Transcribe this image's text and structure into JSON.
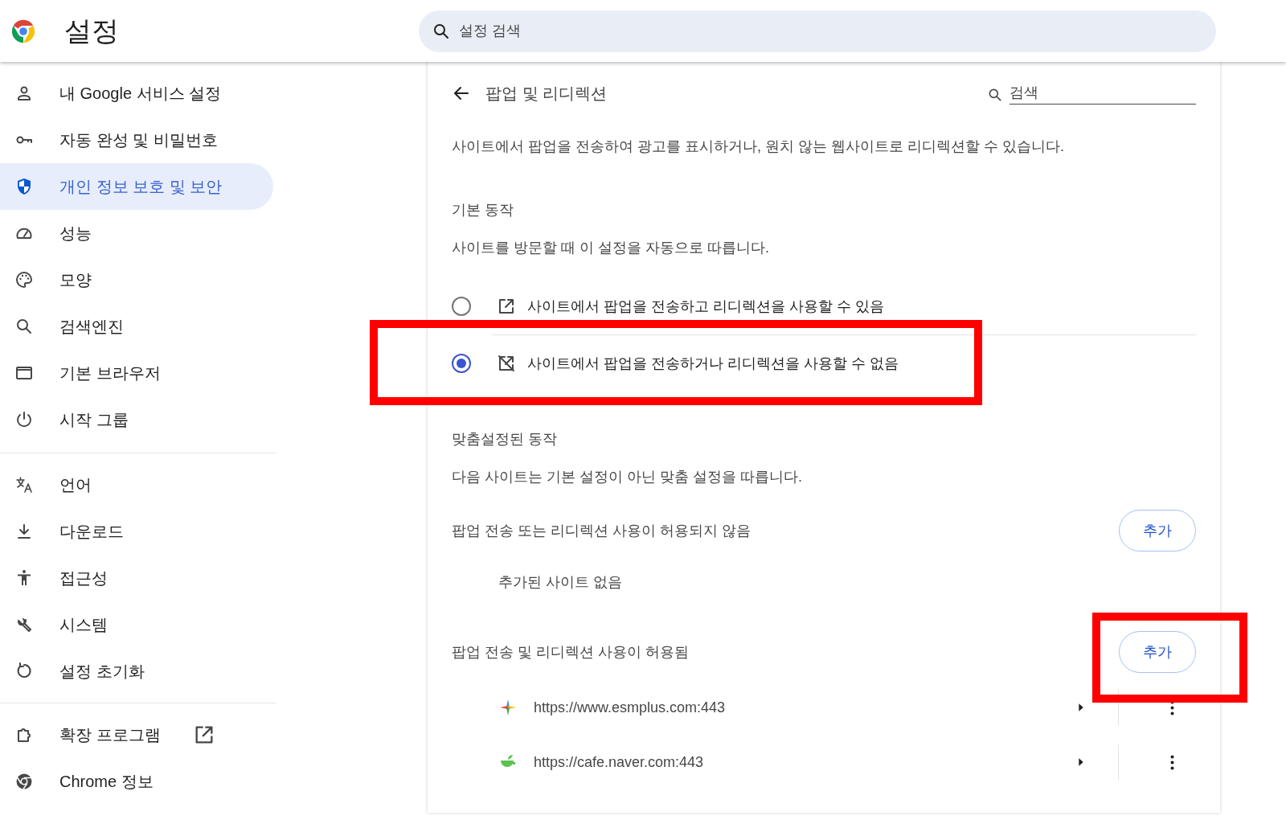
{
  "header": {
    "title": "설정",
    "search": {
      "placeholder": "설정 검색"
    }
  },
  "sidebar": {
    "groups": [
      {
        "items": [
          {
            "label": "내 Google 서비스 설정",
            "selected": false,
            "external": false
          },
          {
            "label": "자동 완성 및 비밀번호",
            "selected": false,
            "external": false
          },
          {
            "label": "개인 정보 보호 및 보안",
            "selected": true,
            "external": false
          },
          {
            "label": "성능",
            "selected": false,
            "external": false
          },
          {
            "label": "모양",
            "selected": false,
            "external": false
          },
          {
            "label": "검색엔진",
            "selected": false,
            "external": false
          },
          {
            "label": "기본 브라우저",
            "selected": false,
            "external": false
          },
          {
            "label": "시작 그룹",
            "selected": false,
            "external": false
          }
        ]
      },
      {
        "items": [
          {
            "label": "언어",
            "selected": false,
            "external": false
          },
          {
            "label": "다운로드",
            "selected": false,
            "external": false
          },
          {
            "label": "접근성",
            "selected": false,
            "external": false
          },
          {
            "label": "시스템",
            "selected": false,
            "external": false
          },
          {
            "label": "설정 초기화",
            "selected": false,
            "external": false
          }
        ]
      },
      {
        "items": [
          {
            "label": "확장 프로그램",
            "selected": false,
            "external": true
          },
          {
            "label": "Chrome 정보",
            "selected": false,
            "external": false
          }
        ]
      }
    ]
  },
  "page": {
    "title": "팝업 및 리디렉션",
    "search": {
      "placeholder": "검색"
    },
    "description": "사이트에서 팝업을 전송하여 광고를 표시하거나, 원치 않는 웹사이트로 리디렉션할 수 있습니다.",
    "default_behavior": {
      "heading": "기본 동작",
      "subtitle": "사이트를 방문할 때 이 설정을 자동으로 따릅니다.",
      "options": [
        {
          "label": "사이트에서 팝업을 전송하고 리디렉션을 사용할 수 있음",
          "selected": false
        },
        {
          "label": "사이트에서 팝업을 전송하거나 리디렉션을 사용할 수 없음",
          "selected": true
        }
      ]
    },
    "custom_behavior": {
      "heading": "맞춤설정된 동작",
      "subtitle": "다음 사이트는 기본 설정이 아닌 맞춤 설정을 따릅니다.",
      "lists": [
        {
          "title": "팝업 전송 또는 리디렉션 사용이 허용되지 않음",
          "add_button": "추가",
          "empty_text": "추가된 사이트 없음"
        },
        {
          "title": "팝업 전송 및 리디렉션 사용이 허용됨",
          "add_button": "추가",
          "sites": [
            {
              "url": "https://www.esmplus.com:443"
            },
            {
              "url": "https://cafe.naver.com:443"
            }
          ]
        }
      ]
    }
  }
}
